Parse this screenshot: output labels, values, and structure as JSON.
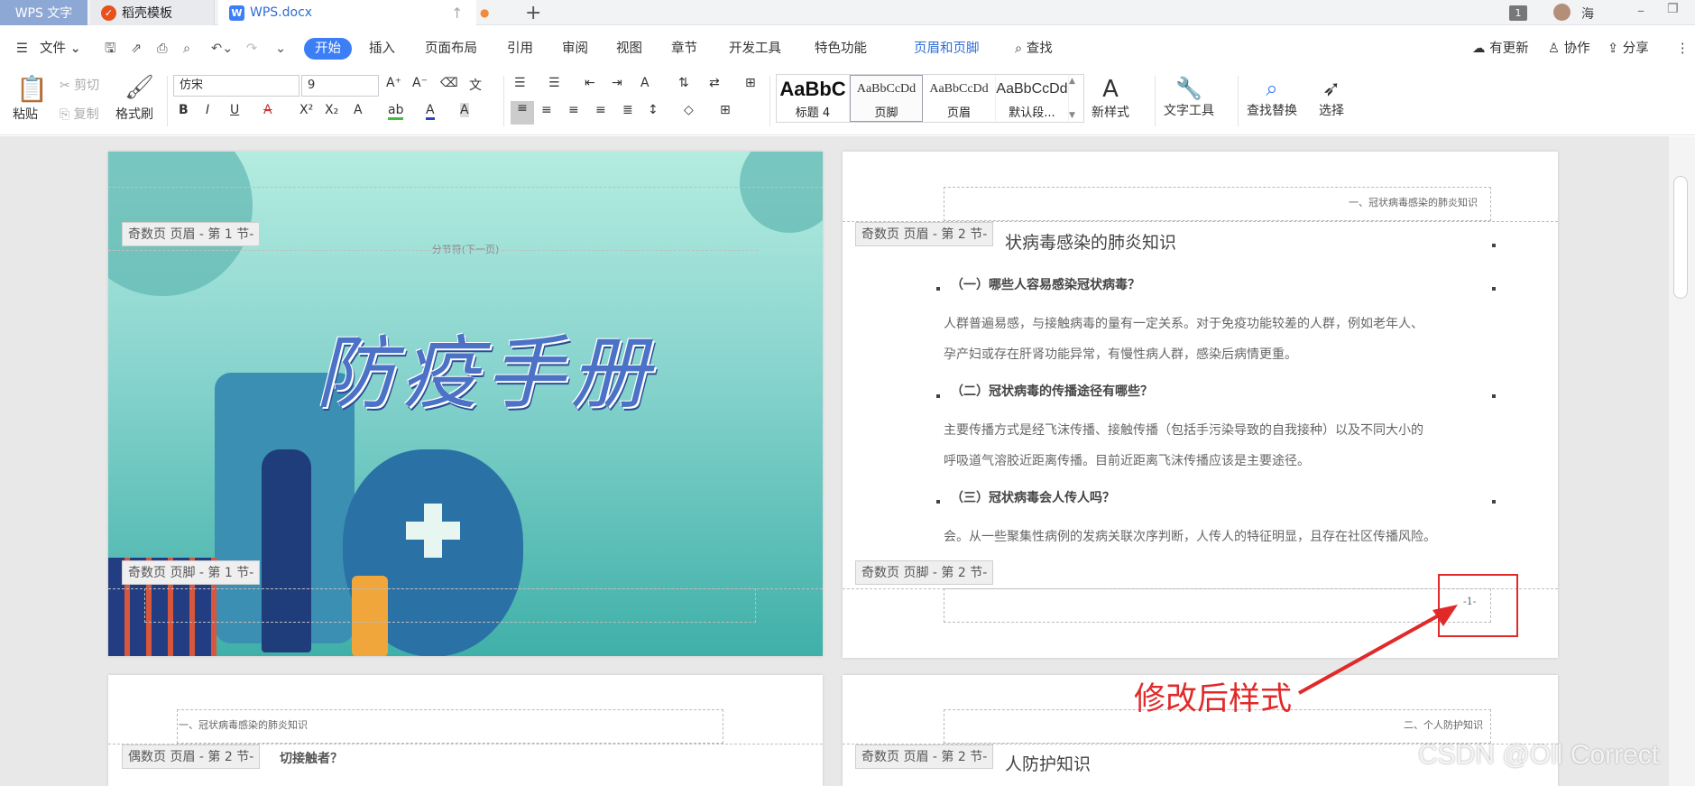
{
  "tabs": [
    {
      "label": "WPS 文字"
    },
    {
      "label": "稻壳模板"
    },
    {
      "label": "WPS.docx"
    }
  ],
  "titlebar": {
    "badge": "1",
    "user": "海"
  },
  "menu": {
    "file": "文件",
    "items": [
      "开始",
      "插入",
      "页面布局",
      "引用",
      "审阅",
      "视图",
      "章节",
      "开发工具",
      "特色功能",
      "页眉和页脚"
    ],
    "search": "查找",
    "update": "有更新",
    "collab": "协作",
    "share": "分享"
  },
  "toolbar": {
    "paste": "粘贴",
    "cut": "剪切",
    "copy": "复制",
    "format_painter": "格式刷",
    "font": "仿宋",
    "size": "9",
    "new_style": "新样式",
    "text_tools": "文字工具",
    "find_replace": "查找替换",
    "select": "选择",
    "styles": [
      {
        "sample": "AaBbC",
        "name": "标题 4"
      },
      {
        "sample": "AaBbCcDd",
        "name": "页脚"
      },
      {
        "sample": "AaBbCcDd",
        "name": "页眉"
      },
      {
        "sample": "AaBbCcDd",
        "name": "默认段..."
      }
    ]
  },
  "pages": {
    "p1": {
      "header_tag": "奇数页 页眉  - 第 1 节-",
      "footer_tag": "奇数页 页脚  - 第 1 节-",
      "section_break": "分节符(下一页)",
      "title": "防疫手册"
    },
    "p2": {
      "header_text": "一、冠状病毒感染的肺炎知识",
      "header_tag": "奇数页 页眉  - 第 2 节-",
      "footer_tag": "奇数页 页脚  - 第 2 节-",
      "heading": "状病毒感染的肺炎知识",
      "q1": "（一）哪些人容易感染冠状病毒？",
      "a1_l1": "人群普遍易感，与接触病毒的量有一定关系。对于免疫功能较差的人群，例如老年人、",
      "a1_l2": "孕产妇或存在肝肾功能异常，有慢性病人群，感染后病情更重。",
      "q2": "（二）冠状病毒的传播途径有哪些？",
      "a2_l1": "主要传播方式是经飞沫传播、接触传播（包括手污染导致的自我接种）以及不同大小的",
      "a2_l2": "呼吸道气溶胶近距离传播。目前近距离飞沫传播应该是主要途径。",
      "q3": "（三）冠状病毒会人传人吗？",
      "a3_l1": "会。从一些聚集性病例的发病关联次序判断，人传人的特征明显，且存在社区传播风险。",
      "page_num": "-1-"
    },
    "p3": {
      "header_text": "一、冠状病毒感染的肺炎知识",
      "header_tag": "偶数页 页眉  - 第 2 节-",
      "body_frag": "切接触者？"
    },
    "p4": {
      "header_text": "二、个人防护知识",
      "header_tag": "奇数页 页眉  - 第 2 节-",
      "heading": "人防护知识"
    }
  },
  "annotation": "修改后样式",
  "watermark": "CSDN @Oll Correct",
  "colors": {
    "accent": "#3c7ef6",
    "annotation": "#e02a2a",
    "title": "#4b72c6"
  }
}
